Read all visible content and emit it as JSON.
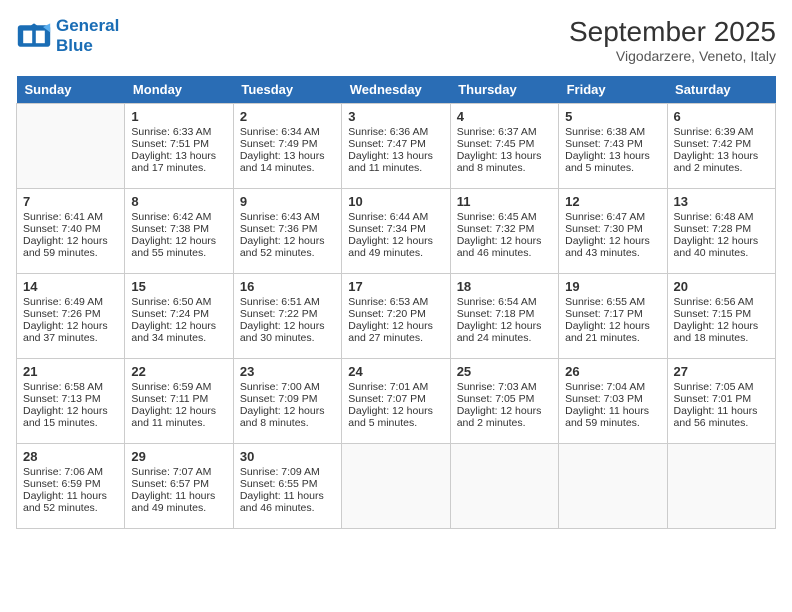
{
  "logo": {
    "line1": "General",
    "line2": "Blue"
  },
  "title": "September 2025",
  "subtitle": "Vigodarzere, Veneto, Italy",
  "days_of_week": [
    "Sunday",
    "Monday",
    "Tuesday",
    "Wednesday",
    "Thursday",
    "Friday",
    "Saturday"
  ],
  "weeks": [
    [
      {
        "day": "",
        "info": ""
      },
      {
        "day": "1",
        "info": "Sunrise: 6:33 AM\nSunset: 7:51 PM\nDaylight: 13 hours\nand 17 minutes."
      },
      {
        "day": "2",
        "info": "Sunrise: 6:34 AM\nSunset: 7:49 PM\nDaylight: 13 hours\nand 14 minutes."
      },
      {
        "day": "3",
        "info": "Sunrise: 6:36 AM\nSunset: 7:47 PM\nDaylight: 13 hours\nand 11 minutes."
      },
      {
        "day": "4",
        "info": "Sunrise: 6:37 AM\nSunset: 7:45 PM\nDaylight: 13 hours\nand 8 minutes."
      },
      {
        "day": "5",
        "info": "Sunrise: 6:38 AM\nSunset: 7:43 PM\nDaylight: 13 hours\nand 5 minutes."
      },
      {
        "day": "6",
        "info": "Sunrise: 6:39 AM\nSunset: 7:42 PM\nDaylight: 13 hours\nand 2 minutes."
      }
    ],
    [
      {
        "day": "7",
        "info": "Sunrise: 6:41 AM\nSunset: 7:40 PM\nDaylight: 12 hours\nand 59 minutes."
      },
      {
        "day": "8",
        "info": "Sunrise: 6:42 AM\nSunset: 7:38 PM\nDaylight: 12 hours\nand 55 minutes."
      },
      {
        "day": "9",
        "info": "Sunrise: 6:43 AM\nSunset: 7:36 PM\nDaylight: 12 hours\nand 52 minutes."
      },
      {
        "day": "10",
        "info": "Sunrise: 6:44 AM\nSunset: 7:34 PM\nDaylight: 12 hours\nand 49 minutes."
      },
      {
        "day": "11",
        "info": "Sunrise: 6:45 AM\nSunset: 7:32 PM\nDaylight: 12 hours\nand 46 minutes."
      },
      {
        "day": "12",
        "info": "Sunrise: 6:47 AM\nSunset: 7:30 PM\nDaylight: 12 hours\nand 43 minutes."
      },
      {
        "day": "13",
        "info": "Sunrise: 6:48 AM\nSunset: 7:28 PM\nDaylight: 12 hours\nand 40 minutes."
      }
    ],
    [
      {
        "day": "14",
        "info": "Sunrise: 6:49 AM\nSunset: 7:26 PM\nDaylight: 12 hours\nand 37 minutes."
      },
      {
        "day": "15",
        "info": "Sunrise: 6:50 AM\nSunset: 7:24 PM\nDaylight: 12 hours\nand 34 minutes."
      },
      {
        "day": "16",
        "info": "Sunrise: 6:51 AM\nSunset: 7:22 PM\nDaylight: 12 hours\nand 30 minutes."
      },
      {
        "day": "17",
        "info": "Sunrise: 6:53 AM\nSunset: 7:20 PM\nDaylight: 12 hours\nand 27 minutes."
      },
      {
        "day": "18",
        "info": "Sunrise: 6:54 AM\nSunset: 7:18 PM\nDaylight: 12 hours\nand 24 minutes."
      },
      {
        "day": "19",
        "info": "Sunrise: 6:55 AM\nSunset: 7:17 PM\nDaylight: 12 hours\nand 21 minutes."
      },
      {
        "day": "20",
        "info": "Sunrise: 6:56 AM\nSunset: 7:15 PM\nDaylight: 12 hours\nand 18 minutes."
      }
    ],
    [
      {
        "day": "21",
        "info": "Sunrise: 6:58 AM\nSunset: 7:13 PM\nDaylight: 12 hours\nand 15 minutes."
      },
      {
        "day": "22",
        "info": "Sunrise: 6:59 AM\nSunset: 7:11 PM\nDaylight: 12 hours\nand 11 minutes."
      },
      {
        "day": "23",
        "info": "Sunrise: 7:00 AM\nSunset: 7:09 PM\nDaylight: 12 hours\nand 8 minutes."
      },
      {
        "day": "24",
        "info": "Sunrise: 7:01 AM\nSunset: 7:07 PM\nDaylight: 12 hours\nand 5 minutes."
      },
      {
        "day": "25",
        "info": "Sunrise: 7:03 AM\nSunset: 7:05 PM\nDaylight: 12 hours\nand 2 minutes."
      },
      {
        "day": "26",
        "info": "Sunrise: 7:04 AM\nSunset: 7:03 PM\nDaylight: 11 hours\nand 59 minutes."
      },
      {
        "day": "27",
        "info": "Sunrise: 7:05 AM\nSunset: 7:01 PM\nDaylight: 11 hours\nand 56 minutes."
      }
    ],
    [
      {
        "day": "28",
        "info": "Sunrise: 7:06 AM\nSunset: 6:59 PM\nDaylight: 11 hours\nand 52 minutes."
      },
      {
        "day": "29",
        "info": "Sunrise: 7:07 AM\nSunset: 6:57 PM\nDaylight: 11 hours\nand 49 minutes."
      },
      {
        "day": "30",
        "info": "Sunrise: 7:09 AM\nSunset: 6:55 PM\nDaylight: 11 hours\nand 46 minutes."
      },
      {
        "day": "",
        "info": ""
      },
      {
        "day": "",
        "info": ""
      },
      {
        "day": "",
        "info": ""
      },
      {
        "day": "",
        "info": ""
      }
    ]
  ]
}
